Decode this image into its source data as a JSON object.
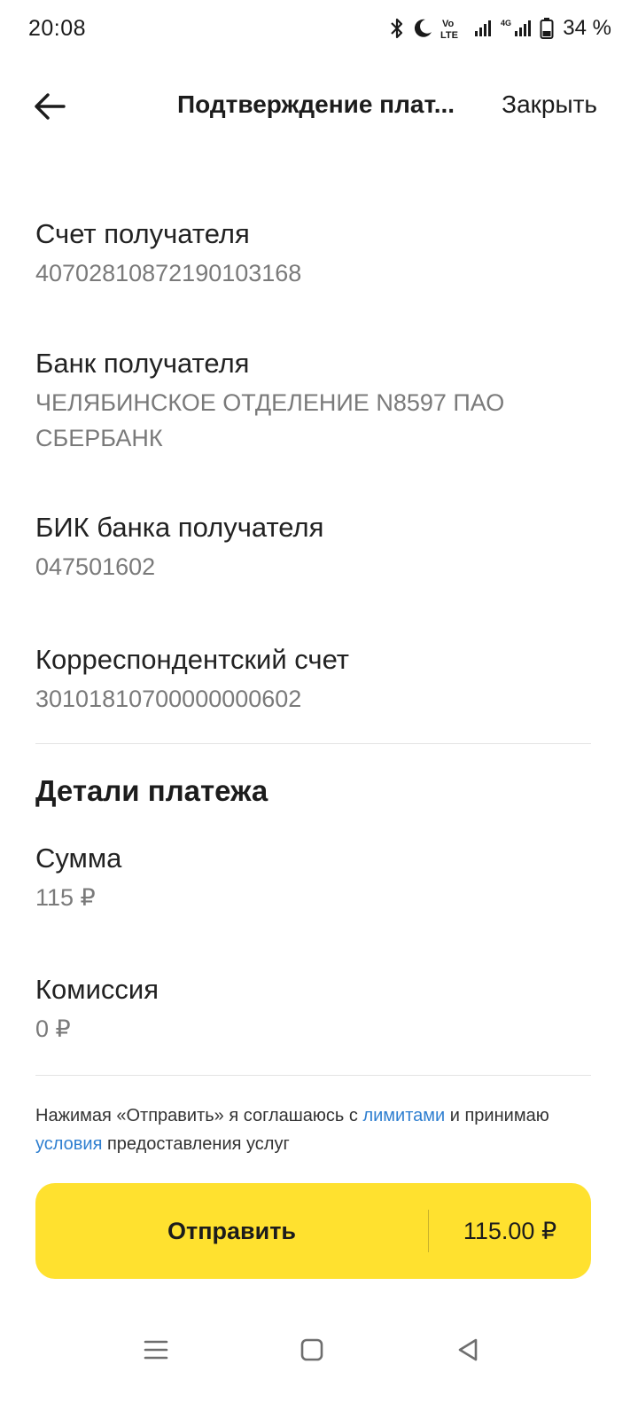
{
  "status": {
    "time": "20:08",
    "battery": "34 %"
  },
  "header": {
    "title": "Подтверждение плат...",
    "close_label": "Закрыть"
  },
  "fields": [
    {
      "label": "Счет получателя",
      "value": "40702810872190103168"
    },
    {
      "label": "Банк получателя",
      "value": "ЧЕЛЯБИНСКОЕ ОТДЕЛЕНИЕ N8597 ПАО СБЕРБАНК"
    },
    {
      "label": "БИК банка получателя",
      "value": "047501602"
    },
    {
      "label": "Корреспондентский счет",
      "value": "30101810700000000602"
    }
  ],
  "details": {
    "title": "Детали платежа",
    "amount_label": "Сумма",
    "amount_value": "115 ₽",
    "fee_label": "Комиссия",
    "fee_value": "0 ₽"
  },
  "agreement": {
    "part1": "Нажимая «Отправить» я соглашаюсь с ",
    "limits_link": "лимитами",
    "part2": " и принимаю ",
    "terms_link": "условия",
    "part3": " предоставления услуг"
  },
  "send_button": {
    "label": "Отправить",
    "amount": "115.00 ₽"
  },
  "colors": {
    "accent": "#ffe12f",
    "link": "#2f7fd0"
  }
}
